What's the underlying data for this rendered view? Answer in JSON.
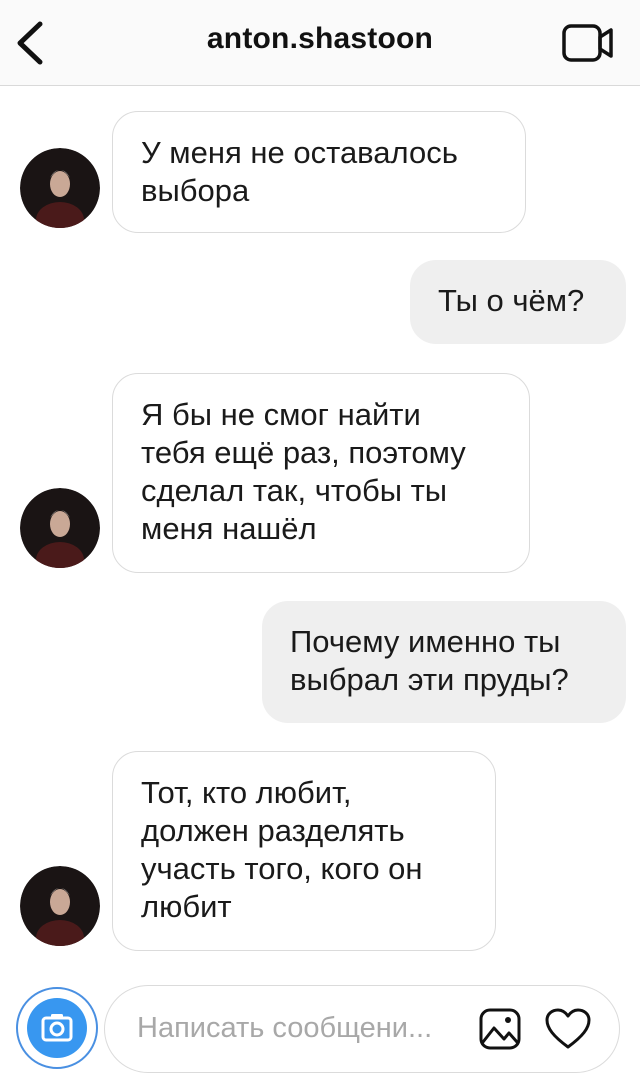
{
  "header": {
    "username": "anton.shastoon",
    "back_icon": "chevron-left-icon",
    "video_icon": "video-camera-icon"
  },
  "messages": [
    {
      "side": "incoming",
      "text": "У меня не оставалось\nвыбора"
    },
    {
      "side": "outgoing",
      "text": "Ты о чём?"
    },
    {
      "side": "incoming",
      "text": "Я бы не смог найти\nтебя ещё раз, поэтому\nсделал так, чтобы ты\nменя нашёл"
    },
    {
      "side": "outgoing",
      "text": "Почему именно ты\nвыбрал эти пруды?"
    },
    {
      "side": "incoming",
      "text": "Тот, кто любит,\nдолжен разделять\nучасть того, кого он\nлюбит"
    }
  ],
  "composer": {
    "placeholder": "Написать сообщени...",
    "camera_icon": "camera-icon",
    "gallery_icon": "gallery-icon",
    "heart_icon": "heart-icon"
  },
  "colors": {
    "accent": "#3897f0",
    "incoming_border": "#dbdbdb",
    "outgoing_bg": "#efefef",
    "placeholder": "#a8a8a8"
  }
}
